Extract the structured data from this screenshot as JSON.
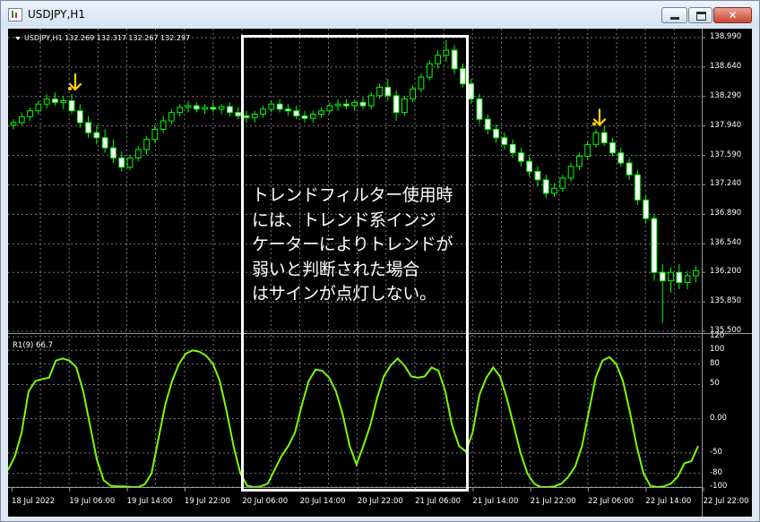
{
  "window": {
    "title": "USDJPY,H1",
    "buttons": {
      "minimize": "minimize",
      "maximize": "maximize",
      "close": "✕"
    }
  },
  "main_panel": {
    "info": "USDJPY,H1  132.269 132.317 132.267 132.297",
    "price_ticks": [
      "138.990",
      "138.640",
      "138.290",
      "137.940",
      "137.590",
      "137.240",
      "136.890",
      "136.540",
      "136.200",
      "135.850",
      "135.500"
    ]
  },
  "indicator_panel": {
    "label": "R1(9) 66.7",
    "ticks": [
      "120",
      "100",
      "80",
      "50",
      "0.00",
      "-50",
      "-80",
      "-100"
    ]
  },
  "time_axis": [
    "18 Jul 2022",
    "19 Jul 06:00",
    "19 Jul 14:00",
    "19 Jul 22:00",
    "20 Jul 06:00",
    "20 Jul 14:00",
    "20 Jul 22:00",
    "21 Jul 06:00",
    "21 Jul 14:00",
    "21 Jul 22:00",
    "22 Jul 06:00",
    "22 Jul 14:00",
    "22 Jul 22:00"
  ],
  "annotation": {
    "text": "トレンドフィルター使用時\nには、トレンド系インジ\nケーターによりトレンドが\n弱いと判断された場合\nはサインが点灯しない。"
  },
  "colors": {
    "background": "#000000",
    "bull_candle": "#000000",
    "bear_candle": "#ffffff",
    "wick": "#00ff00",
    "indicator_line": "#7cfc00",
    "signal_arrow": "#ffd400",
    "highlight_box": "#ffffff"
  },
  "chart_data": {
    "type": "candlestick",
    "y_range_price": [
      135.5,
      138.99
    ],
    "y_range_indicator": [
      -100,
      120
    ],
    "candles": [
      [
        137.95,
        138.02,
        137.9,
        137.98
      ],
      [
        137.98,
        138.1,
        137.95,
        138.05
      ],
      [
        138.05,
        138.16,
        138.0,
        138.12
      ],
      [
        138.12,
        138.24,
        138.08,
        138.2
      ],
      [
        138.2,
        138.32,
        138.15,
        138.26
      ],
      [
        138.26,
        138.34,
        138.18,
        138.22
      ],
      [
        138.22,
        138.3,
        138.14,
        138.24
      ],
      [
        138.24,
        138.32,
        138.08,
        138.12
      ],
      [
        138.12,
        138.2,
        137.92,
        137.98
      ],
      [
        137.98,
        138.06,
        137.8,
        137.86
      ],
      [
        137.86,
        137.95,
        137.72,
        137.8
      ],
      [
        137.8,
        137.9,
        137.62,
        137.68
      ],
      [
        137.68,
        137.78,
        137.5,
        137.56
      ],
      [
        137.56,
        137.64,
        137.4,
        137.45
      ],
      [
        137.45,
        137.6,
        137.42,
        137.56
      ],
      [
        137.56,
        137.7,
        137.52,
        137.66
      ],
      [
        137.66,
        137.82,
        137.6,
        137.78
      ],
      [
        137.78,
        137.95,
        137.74,
        137.9
      ],
      [
        137.9,
        138.06,
        137.86,
        138.0
      ],
      [
        138.0,
        138.14,
        137.96,
        138.1
      ],
      [
        138.1,
        138.2,
        138.05,
        138.16
      ],
      [
        138.16,
        138.24,
        138.1,
        138.18
      ],
      [
        138.18,
        138.22,
        138.1,
        138.14
      ],
      [
        138.14,
        138.2,
        138.08,
        138.16
      ],
      [
        138.16,
        138.22,
        138.1,
        138.14
      ],
      [
        138.14,
        138.2,
        138.08,
        138.17
      ],
      [
        138.17,
        138.22,
        138.05,
        138.1
      ],
      [
        138.1,
        138.16,
        138.02,
        138.06
      ],
      [
        138.06,
        138.12,
        137.98,
        138.04
      ],
      [
        138.04,
        138.12,
        137.98,
        138.08
      ],
      [
        138.08,
        138.18,
        138.04,
        138.14
      ],
      [
        138.14,
        138.24,
        138.1,
        138.2
      ],
      [
        138.2,
        138.26,
        138.1,
        138.14
      ],
      [
        138.14,
        138.2,
        138.06,
        138.12
      ],
      [
        138.12,
        138.18,
        138.02,
        138.06
      ],
      [
        138.06,
        138.12,
        137.98,
        138.03
      ],
      [
        138.03,
        138.12,
        137.98,
        138.08
      ],
      [
        138.08,
        138.16,
        138.04,
        138.12
      ],
      [
        138.12,
        138.22,
        138.08,
        138.18
      ],
      [
        138.18,
        138.26,
        138.12,
        138.2
      ],
      [
        138.2,
        138.26,
        138.14,
        138.18
      ],
      [
        138.18,
        138.26,
        138.12,
        138.22
      ],
      [
        138.22,
        138.28,
        138.14,
        138.18
      ],
      [
        138.18,
        138.34,
        138.14,
        138.3
      ],
      [
        138.3,
        138.44,
        138.26,
        138.4
      ],
      [
        138.4,
        138.5,
        138.24,
        138.3
      ],
      [
        138.3,
        138.36,
        138.0,
        138.1
      ],
      [
        138.1,
        138.3,
        138.06,
        138.26
      ],
      [
        138.26,
        138.42,
        138.22,
        138.38
      ],
      [
        138.38,
        138.56,
        138.34,
        138.52
      ],
      [
        138.52,
        138.72,
        138.48,
        138.68
      ],
      [
        138.68,
        138.84,
        138.62,
        138.78
      ],
      [
        138.78,
        138.96,
        138.7,
        138.84
      ],
      [
        138.84,
        138.9,
        138.56,
        138.62
      ],
      [
        138.62,
        138.68,
        138.4,
        138.44
      ],
      [
        138.44,
        138.5,
        138.2,
        138.26
      ],
      [
        138.26,
        138.32,
        137.96,
        138.02
      ],
      [
        138.02,
        138.08,
        137.84,
        137.9
      ],
      [
        137.9,
        137.96,
        137.74,
        137.8
      ],
      [
        137.8,
        137.86,
        137.66,
        137.72
      ],
      [
        137.72,
        137.78,
        137.56,
        137.62
      ],
      [
        137.62,
        137.68,
        137.46,
        137.52
      ],
      [
        137.52,
        137.58,
        137.34,
        137.4
      ],
      [
        137.4,
        137.46,
        137.22,
        137.3
      ],
      [
        137.3,
        137.36,
        137.08,
        137.14
      ],
      [
        137.14,
        137.26,
        137.1,
        137.2
      ],
      [
        137.2,
        137.36,
        137.16,
        137.32
      ],
      [
        137.32,
        137.5,
        137.28,
        137.46
      ],
      [
        137.46,
        137.62,
        137.42,
        137.58
      ],
      [
        137.58,
        137.76,
        137.54,
        137.72
      ],
      [
        137.72,
        137.9,
        137.68,
        137.86
      ],
      [
        137.86,
        137.94,
        137.7,
        137.74
      ],
      [
        137.74,
        137.8,
        137.58,
        137.62
      ],
      [
        137.62,
        137.68,
        137.46,
        137.5
      ],
      [
        137.5,
        137.56,
        137.3,
        137.36
      ],
      [
        137.36,
        137.42,
        137.0,
        137.06
      ],
      [
        137.06,
        137.12,
        136.78,
        136.84
      ],
      [
        136.84,
        136.9,
        136.1,
        136.2
      ],
      [
        136.2,
        136.3,
        135.6,
        136.1
      ],
      [
        136.1,
        136.26,
        135.96,
        136.2
      ],
      [
        136.2,
        136.3,
        136.0,
        136.08
      ],
      [
        136.08,
        136.22,
        136.0,
        136.16
      ],
      [
        136.16,
        136.28,
        136.08,
        136.22
      ]
    ],
    "signals": [
      {
        "type": "buy_arrow",
        "candle_index": 7
      },
      {
        "type": "buy_arrow",
        "candle_index": 70
      }
    ],
    "indicator": [
      -75,
      -55,
      -20,
      40,
      55,
      58,
      60,
      85,
      88,
      85,
      75,
      40,
      -10,
      -60,
      -90,
      -98,
      -99,
      -99,
      -100,
      -100,
      -96,
      -80,
      -30,
      20,
      55,
      80,
      95,
      100,
      98,
      92,
      80,
      55,
      10,
      -40,
      -80,
      -98,
      -100,
      -99,
      -95,
      -75,
      -55,
      -40,
      -20,
      20,
      55,
      72,
      70,
      60,
      40,
      5,
      -40,
      -67,
      -40,
      -10,
      30,
      62,
      78,
      88,
      78,
      62,
      60,
      62,
      75,
      70,
      40,
      -10,
      -40,
      -48,
      -20,
      35,
      60,
      75,
      62,
      30,
      -10,
      -50,
      -80,
      -95,
      -100,
      -100,
      -99,
      -95,
      -85,
      -70,
      -40,
      10,
      60,
      85,
      90,
      80,
      55,
      10,
      -40,
      -80,
      -98,
      -100,
      -99,
      -95,
      -85,
      -65,
      -62,
      -40
    ]
  }
}
